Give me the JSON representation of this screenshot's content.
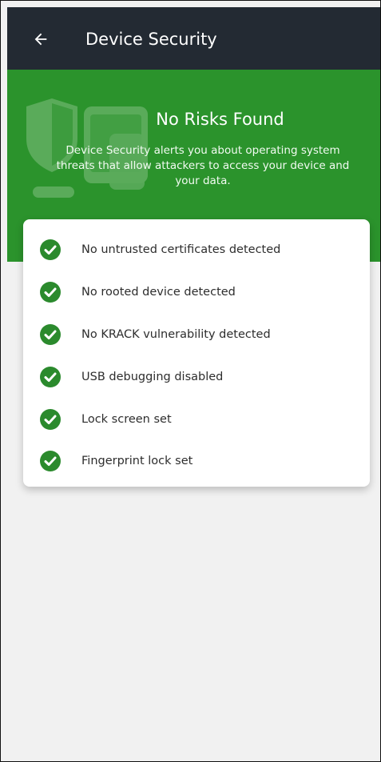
{
  "app_bar": {
    "title": "Device Security",
    "back_icon": "arrow-left-icon",
    "background_color": "#232a33"
  },
  "hero": {
    "heading": "No Risks Found",
    "description": "Device Security alerts you about operating system threats that allow attackers to access your device and your data.",
    "background_color": "#2b932c",
    "illustration_icon": "shield-device-icon"
  },
  "checks": {
    "icon": "check-circle-icon",
    "icon_color": "#2b8a2d",
    "items": [
      {
        "label": "No untrusted certificates detected"
      },
      {
        "label": "No rooted device detected"
      },
      {
        "label": "No KRACK vulnerability detected"
      },
      {
        "label": "USB debugging disabled"
      },
      {
        "label": "Lock screen set"
      },
      {
        "label": "Fingerprint lock set"
      }
    ]
  }
}
